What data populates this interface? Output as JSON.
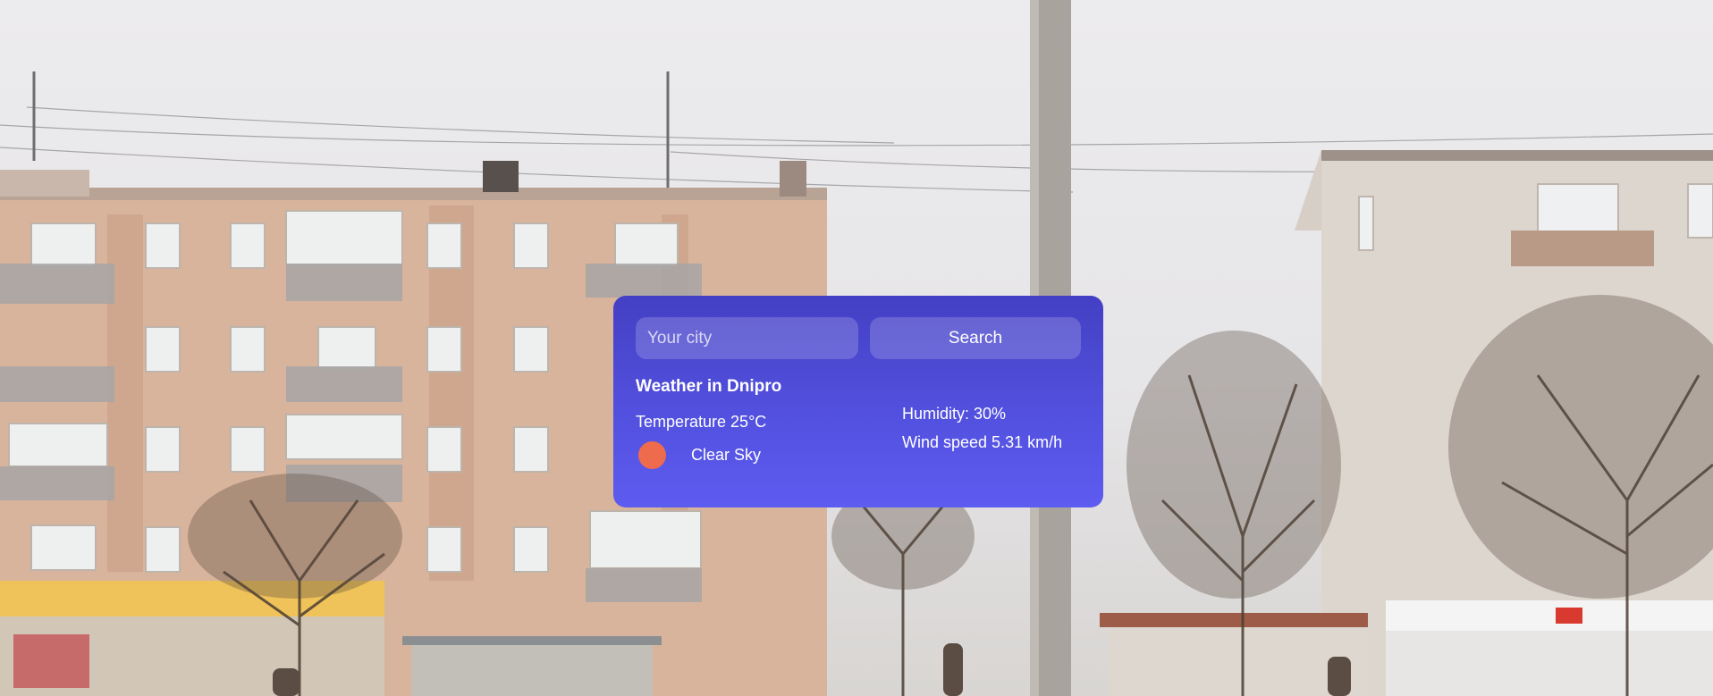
{
  "search": {
    "placeholder": "Your city",
    "button_label": "Search"
  },
  "weather": {
    "title": "Weather in Dnipro",
    "temperature": "Temperature 25°C",
    "condition": "Clear Sky",
    "condition_icon": "sun-icon",
    "humidity": "Humidity: 30%",
    "wind": "Wind speed 5.31 km/h"
  },
  "colors": {
    "card_top": "#4440c4",
    "card_bottom": "#5d5cf0",
    "sun": "#ee6b4d"
  }
}
